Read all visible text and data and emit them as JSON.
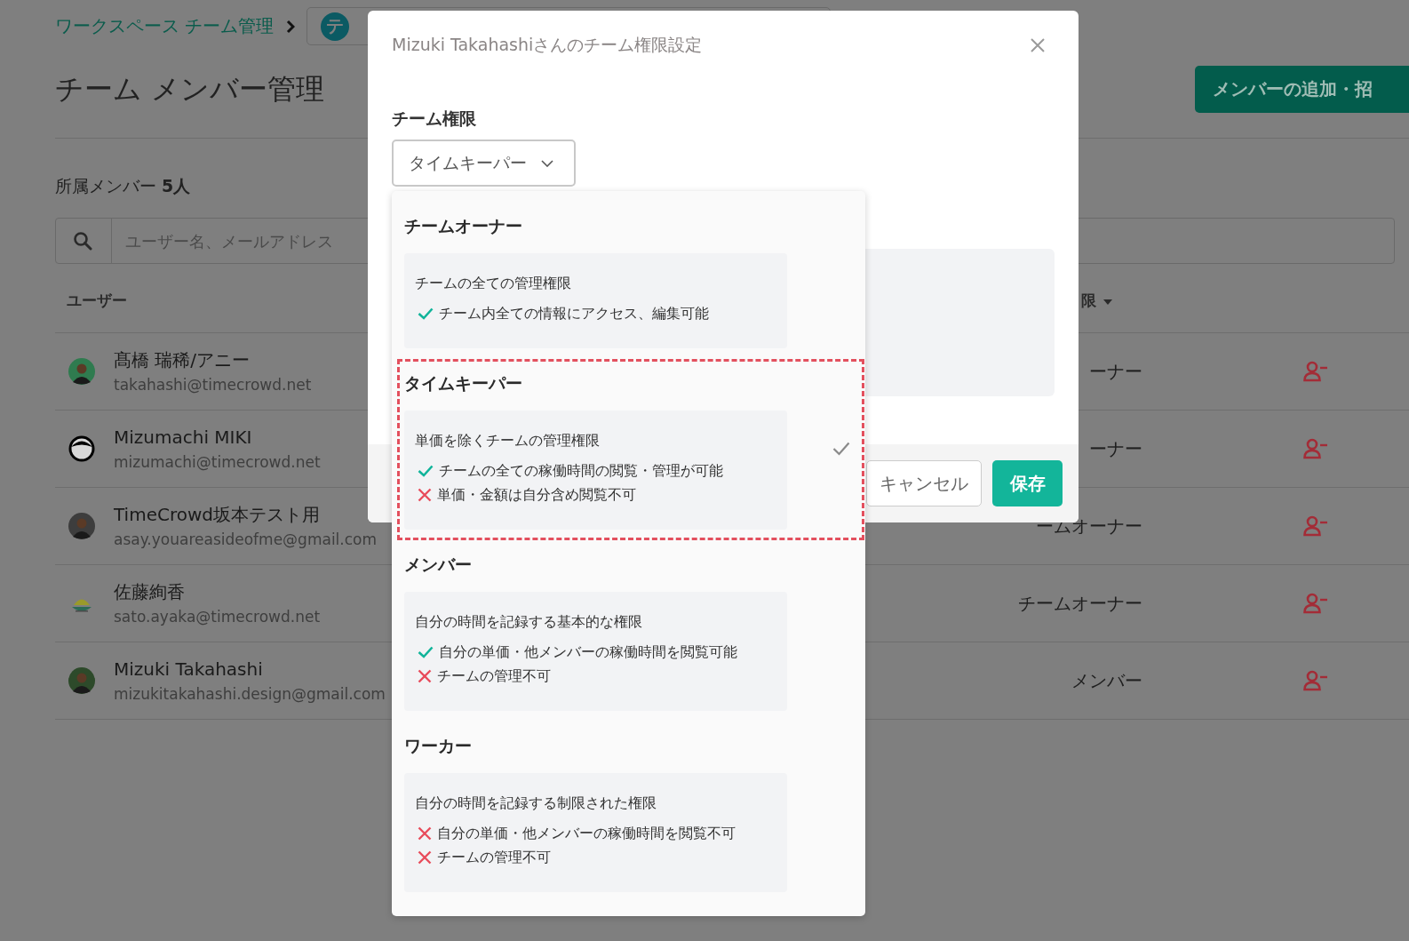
{
  "breadcrumb": {
    "link": "ワークスペース チーム管理",
    "team_avatar": "テ"
  },
  "page_title": "チーム メンバー管理",
  "add_member_button": "メンバーの追加・招",
  "member_count": "所属メンバー **5人**",
  "search": {
    "placeholder": "ユーザー名、メールアドレス"
  },
  "table": {
    "columns": [
      "ユーザー",
      "限"
    ],
    "rows": [
      {
        "name": "髙橋 瑞稀/アニー",
        "email": "takahashi@timecrowd.net",
        "role": "ーナー",
        "avatar": {
          "kind": "photo"
        }
      },
      {
        "name": "Mizumachi MIKI",
        "email": "mizumachi@timecrowd.net",
        "role": "ーナー",
        "avatar": {
          "kind": "face-icon"
        }
      },
      {
        "name": "TimeCrowd坂本テスト用",
        "email": "asay.youareasideofme@gmail.com",
        "role": "ームオーナー",
        "avatar": {
          "kind": "photo"
        }
      },
      {
        "name": "佐藤絢香",
        "email": "sato.ayaka@timecrowd.net",
        "role": "チームオーナー",
        "avatar": {
          "kind": "logo"
        }
      },
      {
        "name": "Mizuki Takahashi",
        "email": "mizukitakahashi.design@gmail.com",
        "role": "メンバー",
        "avatar": {
          "kind": "photo"
        }
      }
    ]
  },
  "modal": {
    "title": "Mizuki Takahashiさんのチーム権限設定",
    "field_label": "チーム権限",
    "select_value": "タイムキーパー",
    "options": [
      {
        "name": "チームオーナー",
        "description": "チームの全ての管理権限",
        "selected": false,
        "highlighted": false,
        "items": [
          {
            "kind": "allowed",
            "text": "チーム内全ての情報にアクセス、編集可能"
          }
        ]
      },
      {
        "name": "タイムキーパー",
        "description": "単価を除くチームの管理権限",
        "selected": true,
        "highlighted": true,
        "items": [
          {
            "kind": "allowed",
            "text": "チームの全ての稼働時間の閲覧・管理が可能"
          },
          {
            "kind": "denied",
            "text": "単価・金額は自分含め閲覧不可"
          }
        ]
      },
      {
        "name": "メンバー",
        "description": "自分の時間を記録する基本的な権限",
        "selected": false,
        "highlighted": false,
        "items": [
          {
            "kind": "allowed",
            "text": "自分の単価・他メンバーの稼働時間を閲覧可能"
          },
          {
            "kind": "denied",
            "text": "チームの管理不可"
          }
        ]
      },
      {
        "name": "ワーカー",
        "description": "自分の時間を記録する制限された権限",
        "selected": false,
        "highlighted": false,
        "items": [
          {
            "kind": "denied",
            "text": "自分の単価・他メンバーの稼働時間を閲覧不可"
          },
          {
            "kind": "denied",
            "text": "チームの管理不可"
          }
        ]
      }
    ],
    "buttons": [
      {
        "label": "キャンセル",
        "kind": "secondary"
      },
      {
        "label": "保存",
        "kind": "primary"
      }
    ]
  }
}
